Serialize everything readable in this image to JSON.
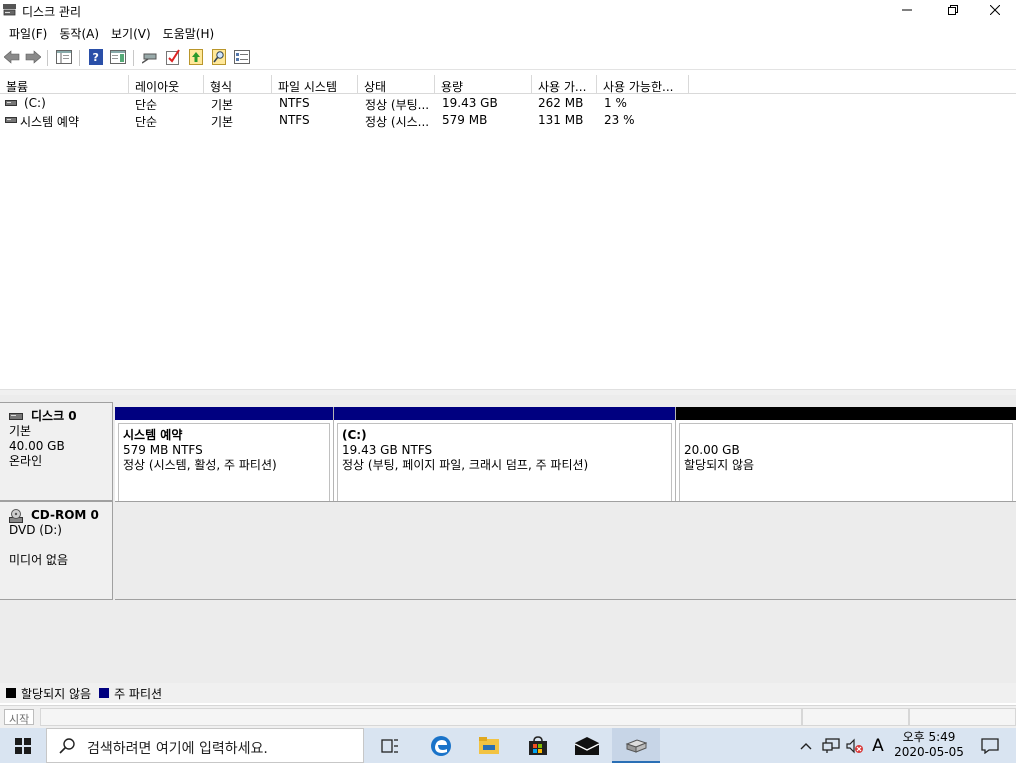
{
  "window": {
    "title": "디스크 관리"
  },
  "menu": [
    {
      "label": "파일(F)"
    },
    {
      "label": "동작(A)"
    },
    {
      "label": "보기(V)"
    },
    {
      "label": "도움말(H)"
    }
  ],
  "toolbar": {
    "icons": [
      "back-icon",
      "forward-icon",
      "console-tree-icon",
      "help-icon",
      "properties-icon",
      "connect-icon",
      "check-icon",
      "export-icon",
      "search-icon",
      "list-icon"
    ]
  },
  "volume_list": {
    "columns": [
      "볼륨",
      "레이아웃",
      "형식",
      "파일 시스템",
      "상태",
      "용량",
      "사용 가...",
      "사용 가능한..."
    ],
    "rows": [
      [
        "(C:)",
        "단순",
        "기본",
        "NTFS",
        "정상 (부팅...",
        "19.43 GB",
        "262 MB",
        "1 %"
      ],
      [
        "시스템 예약",
        "단순",
        "기본",
        "NTFS",
        "정상 (시스...",
        "579 MB",
        "131 MB",
        "23 %"
      ]
    ]
  },
  "disks": {
    "disk0": {
      "name": "디스크 0",
      "type": "기본",
      "size": "40.00 GB",
      "state": "온라인",
      "partitions": [
        {
          "name": "시스템 예약",
          "size": "579 MB NTFS",
          "status": "정상 (시스템, 활성, 주 파티션)",
          "color": "#000080"
        },
        {
          "name": "(C:)",
          "size": "19.43 GB NTFS",
          "status": "정상 (부팅, 페이지 파일, 크래시 덤프, 주 파티션)",
          "color": "#000080"
        },
        {
          "name": "",
          "size": "20.00 GB",
          "status": "할당되지 않음",
          "color": "#000000"
        }
      ]
    },
    "cdrom0": {
      "name": "CD-ROM 0",
      "type": "DVD (D:)",
      "state": "미디어 없음"
    }
  },
  "legend": [
    {
      "label": "할당되지 않음",
      "color": "#000000"
    },
    {
      "label": "주 파티션",
      "color": "#000080"
    }
  ],
  "statusbar": {
    "start_label": "시작"
  },
  "taskbar": {
    "search_placeholder": "검색하려면 여기에 입력하세요.",
    "apps": [
      "task-view-icon",
      "edge-icon",
      "file-explorer-icon",
      "store-icon",
      "mail-icon",
      "disk-management-icon"
    ],
    "ime": "A",
    "time": "오후 5:49",
    "date": "2020-05-05"
  }
}
